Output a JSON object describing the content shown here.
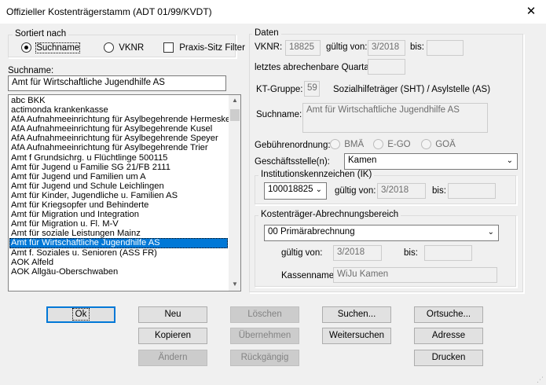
{
  "window": {
    "title": "Offizieller Kostenträgerstamm (ADT 01/99/KVDT)",
    "close_glyph": "✕"
  },
  "sort": {
    "legend": "Sortiert nach",
    "option_name": "Suchname",
    "option_vknr": "VKNR",
    "selected": "Suchname",
    "praxis_filter_label": "Praxis-Sitz Filter",
    "praxis_filter_checked": false
  },
  "search": {
    "label": "Suchname:",
    "value": "Amt für Wirtschaftliche Jugendhilfe AS"
  },
  "list": {
    "items": [
      "abc BKK",
      "actimonda krankenkasse",
      "AfA Aufnahmeeinrichtung für Asylbegehrende Hermeskeil",
      "AfA Aufnahmeeinrichtung für Asylbegehrende Kusel",
      "AfA Aufnahmeeinrichtung für Asylbegehrende Speyer",
      "AfA Aufnahmeeinrichtung für Asylbegehrende Trier",
      "Amt f Grundsichrg. u Flüchtlinge 500115",
      "Amt für Jugend u Familie SG 21/FB 2111",
      "Amt für Jugend und Familien um A",
      "Amt für Jugend und Schule Leichlingen",
      "Amt für Kinder, Jugendliche u. Familien AS",
      "Amt für Kriegsopfer und Behinderte",
      "Amt für Migration und Integration",
      "Amt für Migration u. Fl. M-V",
      "Amt für soziale Leistungen Mainz",
      "Amt für Wirtschaftliche Jugendhilfe AS",
      "Amt f. Soziales u. Senioren (ASS FR)",
      "AOK Alfeld",
      "AOK Allgäu-Oberschwaben"
    ],
    "selected_index": 15,
    "scroll_up": "▲",
    "scroll_down": "▼"
  },
  "daten": {
    "legend": "Daten",
    "vknr_label": "VKNR:",
    "vknr": "18825",
    "gueltig_von_label": "gültig von:",
    "gueltig_von": "3/2018",
    "bis_label": "bis:",
    "bis": "",
    "quartal_label": "letztes abrechenbare Quartal:",
    "quartal": "",
    "kt_gruppe_label": "KT-Gruppe:",
    "kt_gruppe": "59",
    "kt_gruppe_text": "Sozialhilfeträger (SHT) / Asylstelle (AS)",
    "suchname_label": "Suchname:",
    "suchname": "Amt für Wirtschaftliche Jugendhilfe AS",
    "gebuehren_label": "Gebührenordnung:",
    "gebuehren_options": [
      "BMÄ",
      "E-GO",
      "GOÄ"
    ],
    "geschaeftsstelle_label": "Geschäftsstelle(n):",
    "geschaeftsstelle": "Kamen"
  },
  "ik": {
    "legend": "Institutionskennzeichen (IK)",
    "value": "100018825",
    "gueltig_von_label": "gültig von:",
    "gueltig_von": "3/2018",
    "bis_label": "bis:",
    "bis": ""
  },
  "abrechnung": {
    "legend": "Kostenträger-Abrechnungsbereich",
    "bereich": "00  Primärabrechnung",
    "gueltig_von_label": "gültig von:",
    "gueltig_von": "3/2018",
    "bis_label": "bis:",
    "bis": "",
    "kassenname_label": "Kassenname:",
    "kassenname": "WiJu Kamen"
  },
  "buttons": {
    "ok": "Ok",
    "neu": "Neu",
    "kopieren": "Kopieren",
    "aendern": "Ändern",
    "loeschen": "Löschen",
    "uebernehmen": "Übernehmen",
    "rueckgaengig": "Rückgängig",
    "suchen": "Suchen...",
    "weitersuchen": "Weitersuchen",
    "ortsuche": "Ortsuche...",
    "adresse": "Adresse",
    "drucken": "Drucken"
  },
  "colors": {
    "selection": "#0078d7",
    "dialog_bg": "#f0f0f0",
    "default_button_border": "#0078d7"
  }
}
